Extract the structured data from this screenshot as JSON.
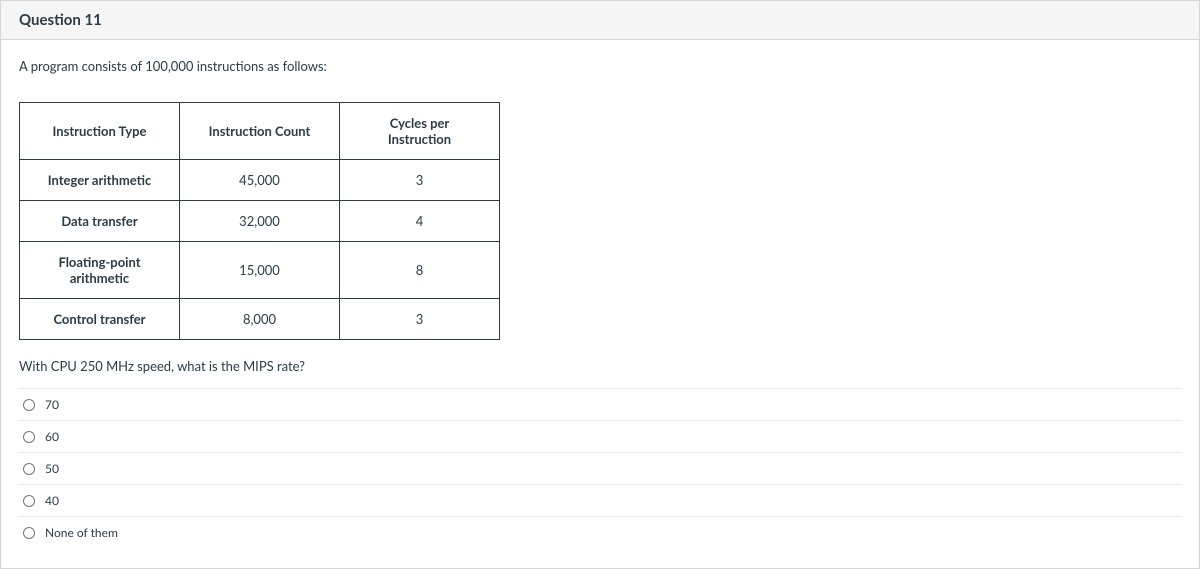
{
  "header": {
    "title": "Question 11"
  },
  "intro": "A program consists of 100,000 instructions as follows:",
  "table": {
    "headers": [
      "Instruction Type",
      "Instruction Count",
      "Cycles per Instruction"
    ],
    "rows": [
      [
        "Integer arithmetic",
        "45,000",
        "3"
      ],
      [
        "Data transfer",
        "32,000",
        "4"
      ],
      [
        "Floating-point arithmetic",
        "15,000",
        "8"
      ],
      [
        "Control transfer",
        "8,000",
        "3"
      ]
    ]
  },
  "follow": "With CPU 250 MHz speed, what is the MIPS rate?",
  "options": [
    {
      "label": "70"
    },
    {
      "label": "60"
    },
    {
      "label": "50"
    },
    {
      "label": "40"
    },
    {
      "label": "None of them"
    }
  ]
}
